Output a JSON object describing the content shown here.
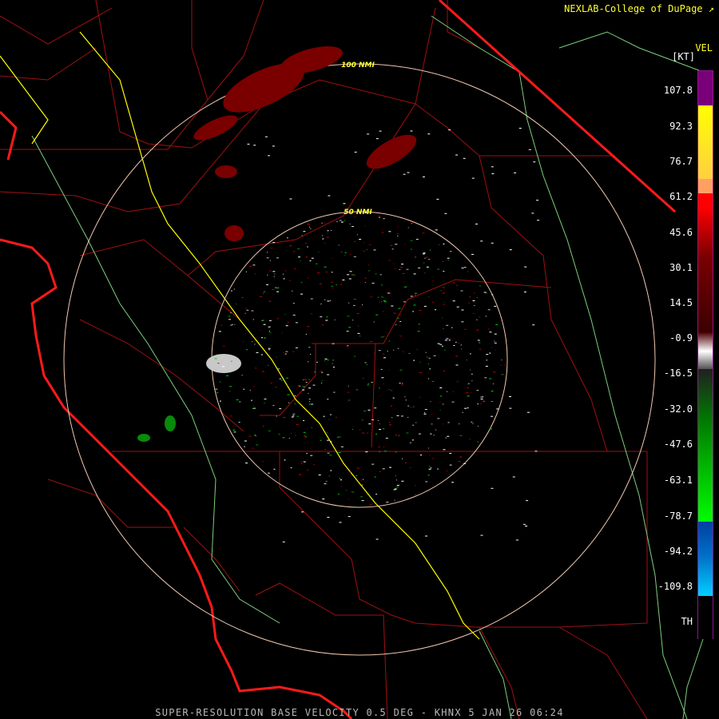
{
  "credit": "NEXLAB-College of DuPage",
  "credit_icon": "external-link-icon",
  "product_label": "VEL",
  "unit_label": "[KT]",
  "legend": {
    "tick_labels": [
      "107.8",
      "92.3",
      "76.7",
      "61.2",
      "45.6",
      "30.1",
      "14.5",
      "-0.9",
      "-16.5",
      "-32.0",
      "-47.6",
      "-63.1",
      "-78.7",
      "-94.2",
      "-109.8",
      "TH"
    ],
    "colors": [
      "#7a007a",
      "#ffff00",
      "#ffa060",
      "#ff0000",
      "#7a0000",
      "#ffffff",
      "#007a00",
      "#00ff00",
      "#0050a0",
      "#00c8ff",
      "#000000"
    ]
  },
  "range_rings": [
    "100 NMI",
    "50 NMI"
  ],
  "caption": "SUPER-RESOLUTION BASE VELOCITY 0.5 DEG - KHNX 5 JAN 26 06:24",
  "colors": {
    "background": "#000000",
    "county_lines": "#a01010",
    "state_coast": "#ff1a1a",
    "highways": "#ffff00",
    "terrain_lines": "#7ccf7c",
    "range_rings": "#f0c8b0"
  }
}
